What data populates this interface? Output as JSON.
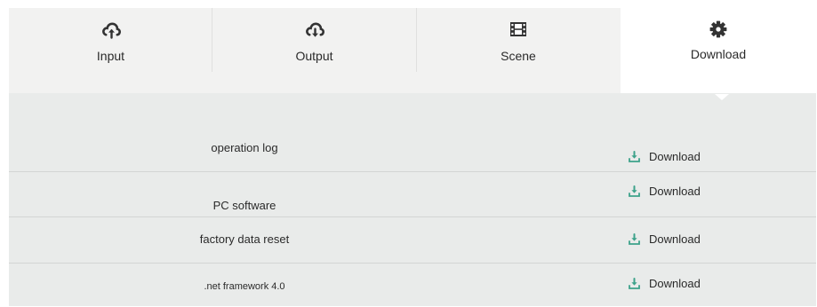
{
  "colors": {
    "tab_bar_bg": "#f2f2f1",
    "active_tab_bg": "#ffffff",
    "content_bg": "#e9ebea",
    "icon_dark": "#333333",
    "download_icon": "#3da28a"
  },
  "tabs": [
    {
      "label": "Input",
      "icon": "cloud-upload-icon"
    },
    {
      "label": "Output",
      "icon": "cloud-download-icon"
    },
    {
      "label": "Scene",
      "icon": "film-icon"
    },
    {
      "label": "Download",
      "icon": "gear-icon",
      "active": true
    }
  ],
  "rows": [
    {
      "label": "operation log",
      "action": "Download",
      "icon": "download-icon"
    },
    {
      "label": "PC software",
      "action": "Download",
      "icon": "download-icon"
    },
    {
      "label": "factory data reset",
      "action": "Download",
      "icon": "download-icon"
    },
    {
      "label": ".net framework 4.0",
      "action": "Download",
      "icon": "download-icon"
    }
  ]
}
